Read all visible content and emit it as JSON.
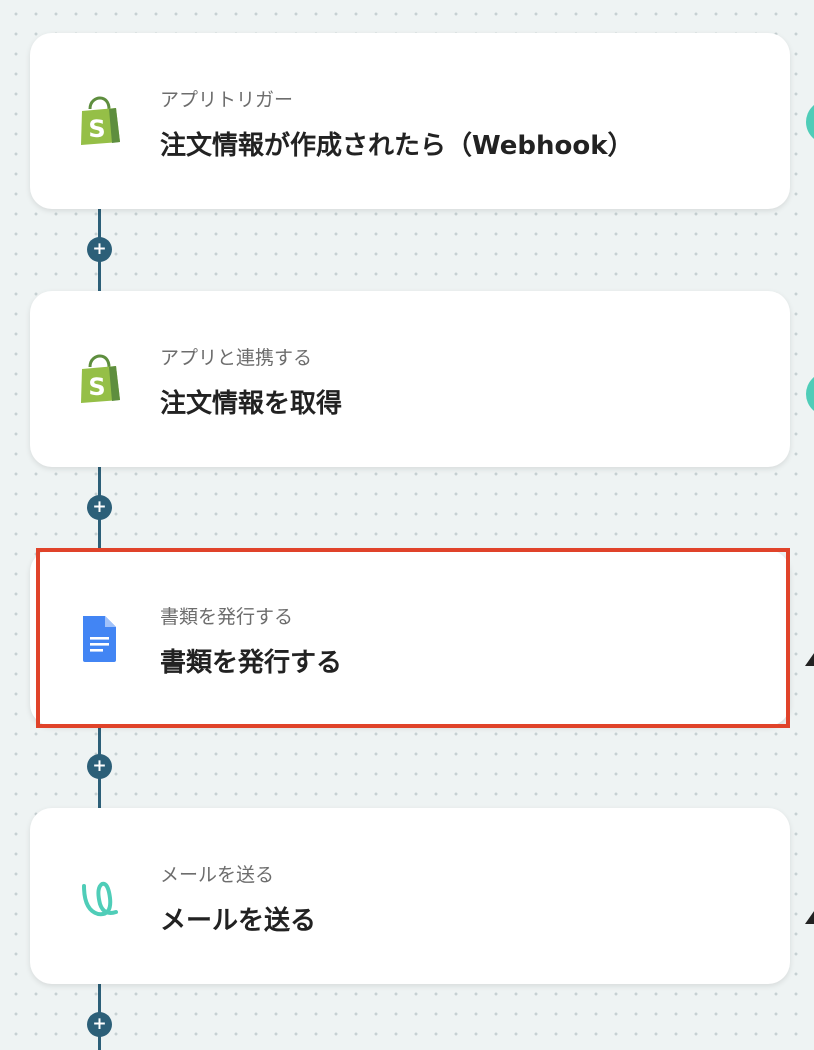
{
  "steps": [
    {
      "label": "アプリトリガー",
      "title": "注文情報が作成されたら（Webhook）",
      "icon": "shopify-icon"
    },
    {
      "label": "アプリと連携する",
      "title": "注文情報を取得",
      "icon": "shopify-icon"
    },
    {
      "label": "書類を発行する",
      "title": "書類を発行する",
      "icon": "google-docs-icon"
    },
    {
      "label": "メールを送る",
      "title": "メールを送る",
      "icon": "yoom-mail-icon"
    }
  ],
  "add_button_symbol": "+",
  "colors": {
    "connector": "#2c5f78",
    "highlight": "#e0432a",
    "accent": "#4fcdb8",
    "shopify_green": "#95bf47",
    "docs_blue": "#4285f4"
  }
}
